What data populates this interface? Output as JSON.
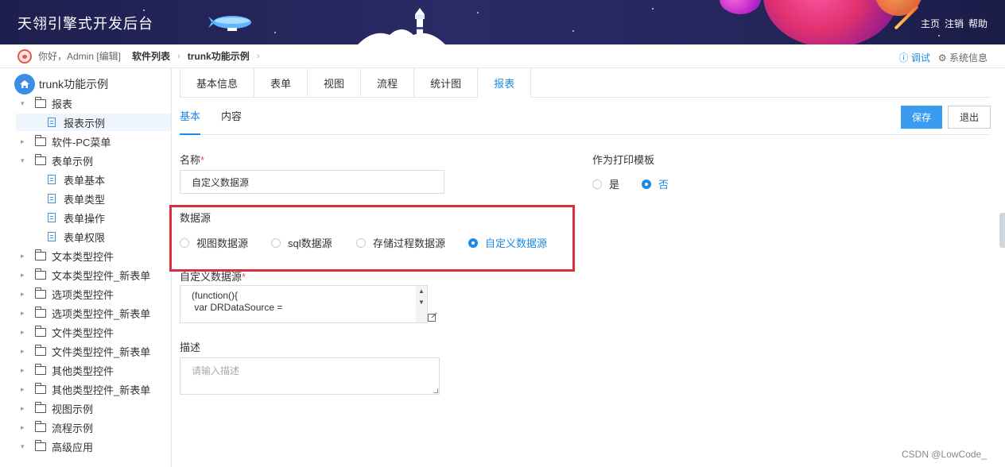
{
  "header": {
    "brand": "天翎引擎式开发后台",
    "links": [
      "主页",
      "注销",
      "帮助"
    ]
  },
  "breadcrumb": {
    "greeting": "你好，Admin [编辑]",
    "items": [
      "软件列表",
      "trunk功能示例"
    ],
    "right": {
      "debug": "调试",
      "sysinfo": "系统信息"
    }
  },
  "sidebar": {
    "root": "trunk功能示例",
    "items": [
      {
        "label": "报表",
        "type": "folder",
        "expanded": true,
        "level": 1
      },
      {
        "label": "报表示例",
        "type": "file",
        "level": 2,
        "selected": true
      },
      {
        "label": "软件-PC菜单",
        "type": "folder",
        "expanded": false,
        "level": 1
      },
      {
        "label": "表单示例",
        "type": "folder",
        "expanded": true,
        "level": 1
      },
      {
        "label": "表单基本",
        "type": "file",
        "level": 2
      },
      {
        "label": "表单类型",
        "type": "file",
        "level": 2
      },
      {
        "label": "表单操作",
        "type": "file",
        "level": 2
      },
      {
        "label": "表单权限",
        "type": "file",
        "level": 2
      },
      {
        "label": "文本类型控件",
        "type": "folder",
        "expanded": false,
        "level": 1
      },
      {
        "label": "文本类型控件_新表单",
        "type": "folder",
        "expanded": false,
        "level": 1
      },
      {
        "label": "选项类型控件",
        "type": "folder",
        "expanded": false,
        "level": 1
      },
      {
        "label": "选项类型控件_新表单",
        "type": "folder",
        "expanded": false,
        "level": 1
      },
      {
        "label": "文件类型控件",
        "type": "folder",
        "expanded": false,
        "level": 1
      },
      {
        "label": "文件类型控件_新表单",
        "type": "folder",
        "expanded": false,
        "level": 1
      },
      {
        "label": "其他类型控件",
        "type": "folder",
        "expanded": false,
        "level": 1
      },
      {
        "label": "其他类型控件_新表单",
        "type": "folder",
        "expanded": false,
        "level": 1
      },
      {
        "label": "视图示例",
        "type": "folder",
        "expanded": false,
        "level": 1
      },
      {
        "label": "流程示例",
        "type": "folder",
        "expanded": false,
        "level": 1
      },
      {
        "label": "高级应用",
        "type": "folder",
        "expanded": true,
        "level": 1
      }
    ]
  },
  "tabs": [
    "基本信息",
    "表单",
    "视图",
    "流程",
    "统计图",
    "报表"
  ],
  "active_tab": "报表",
  "subtabs": [
    "基本",
    "内容"
  ],
  "active_subtab": "基本",
  "buttons": {
    "save": "保存",
    "exit": "退出"
  },
  "form": {
    "name_label": "名称",
    "required_mark": "*",
    "name_value": "自定义数据源",
    "print_label": "作为打印模板",
    "print_options": [
      "是",
      "否"
    ],
    "print_selected": "否",
    "datasource_label": "数据源",
    "datasource_options": [
      "视图数据源",
      "sql数据源",
      "存储过程数据源",
      "自定义数据源"
    ],
    "datasource_selected": "自定义数据源",
    "custom_label": "自定义数据源",
    "custom_code_lines": [
      "(function(){",
      " var DRDataSource ="
    ],
    "desc_label": "描述",
    "desc_placeholder": "请输入描述"
  },
  "watermark": "CSDN @LowCode_",
  "colors": {
    "accent": "#1e88e5",
    "highlight_box": "#d82f3f",
    "header_bg": "#23245a"
  }
}
